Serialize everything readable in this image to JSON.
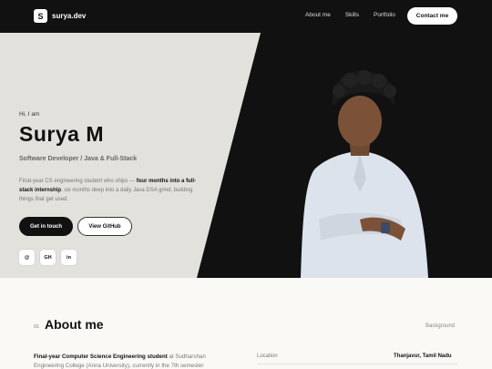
{
  "nav": {
    "logo_mark": "S",
    "logo_text": "surya.dev",
    "links": [
      "About me",
      "Skills",
      "Portfolio"
    ],
    "cta": "Contact me"
  },
  "hero": {
    "greeting": "Hi, I am",
    "name": "Surya M",
    "role": "Software Developer / Java & Full-Stack",
    "desc_prefix": "Final-year CS engineering student who ships — ",
    "desc_bold": "four months into a full-stack internship",
    "desc_suffix": ", six months deep into a daily Java DSA grind, building things that get used.",
    "btn_primary": "Get in touch",
    "btn_secondary": "View GitHub",
    "socials": [
      "@",
      "GH",
      "in"
    ]
  },
  "about": {
    "number": "01",
    "title": "About me",
    "side_label": "Background",
    "text_bold": "Final-year Computer Science Engineering student",
    "text_rest": " at Sudharshan Engineering College (Anna University), currently in the 7th semester",
    "location_label": "Location",
    "location_value": "Thanjavur, Tamil Nadu"
  },
  "colors": {
    "dark": "#111111",
    "hero_light": "#e3e1dc",
    "page_bg": "#faf9f6"
  }
}
